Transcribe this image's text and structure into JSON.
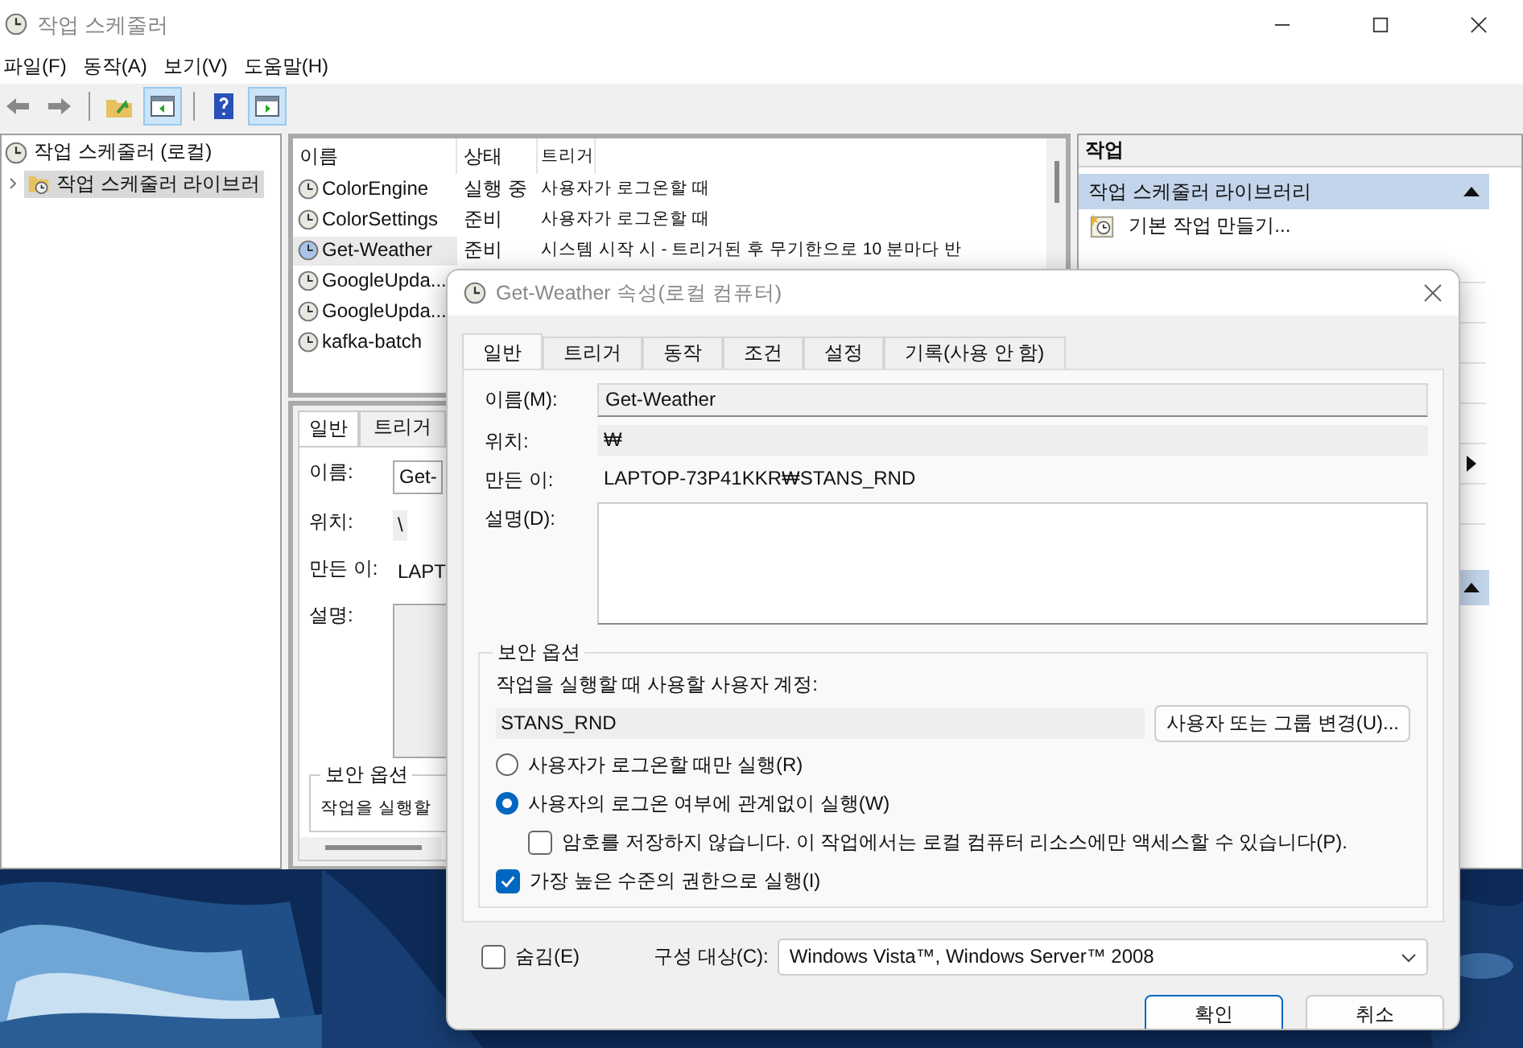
{
  "window": {
    "title": "작업 스케줄러"
  },
  "menu": [
    "파일(F)",
    "동작(A)",
    "보기(V)",
    "도움말(H)"
  ],
  "tree": [
    {
      "label": "작업 스케줄러 (로컬)",
      "selected": false,
      "children": [
        {
          "label": "작업 스케줄러 라이브러",
          "selected": true,
          "expanded": false
        }
      ]
    }
  ],
  "task_list": {
    "columns": [
      "이름",
      "상태",
      "트리거"
    ],
    "rows": [
      {
        "name": "ColorEngine",
        "status": "실행 중",
        "trigger": "사용자가 로그온할 때",
        "selected": false
      },
      {
        "name": "ColorSettings",
        "status": "준비",
        "trigger": "사용자가 로그온할 때",
        "selected": false
      },
      {
        "name": "Get-Weather",
        "status": "준비",
        "trigger": "시스템 시작 시 - 트리거된 후 무기한으로 10 분마다 반",
        "selected": true
      },
      {
        "name": "GoogleUpda...",
        "selected": false
      },
      {
        "name": "GoogleUpda...",
        "selected": false
      },
      {
        "name": "kafka-batch",
        "selected": false
      }
    ]
  },
  "details": {
    "tabs": [
      {
        "label": "일반",
        "selected": true
      },
      {
        "label": "트리거",
        "selected": false
      }
    ],
    "fields": [
      {
        "label": "이름:",
        "value": "Get-",
        "kind": "input"
      },
      {
        "label": "위치:",
        "value": "\\",
        "kind": "readonly"
      },
      {
        "label": "만든 이:",
        "value": "LAPT",
        "kind": "text"
      },
      {
        "label": "설명:",
        "kind": "textarea"
      }
    ],
    "security": {
      "title": "보안 옵션",
      "text": "작업을 실행할"
    }
  },
  "actions": {
    "title": "작업",
    "sections": [
      {
        "title": "작업 스케줄러 라이브러리",
        "expanded": true,
        "items": [
          {
            "label": "기본 작업 만들기..."
          }
        ]
      },
      {
        "expanded": true
      }
    ]
  },
  "dialog": {
    "title": "Get-Weather 속성(로컬 컴퓨터)",
    "tabs": [
      {
        "label": "일반",
        "selected": true
      },
      {
        "label": "트리거",
        "selected": false
      },
      {
        "label": "동작",
        "selected": false
      },
      {
        "label": "조건",
        "selected": false
      },
      {
        "label": "설정",
        "selected": false
      },
      {
        "label": "기록(사용 안 함)",
        "selected": false
      }
    ],
    "fields": [
      {
        "label": "이름(M):",
        "value": "Get-Weather",
        "kind": "input"
      },
      {
        "label": "위치:",
        "value": "₩",
        "kind": "readonly"
      },
      {
        "label": "만든 이:",
        "value": "LAPTOP-73P41KKR₩STANS_RND",
        "kind": "text"
      },
      {
        "label": "설명(D):",
        "kind": "textarea"
      }
    ],
    "security": {
      "title": "보안 옵션",
      "account_label": "작업을 실행할 때 사용할 사용자 계정:",
      "account": "STANS_RND",
      "change_button": "사용자 또는 그룹 변경(U)...",
      "options": [
        {
          "kind": "radio",
          "label": "사용자가 로그온할 때만 실행(R)",
          "selected": false
        },
        {
          "kind": "radio",
          "label": "사용자의 로그온 여부에 관계없이 실행(W)",
          "selected": true,
          "children": [
            {
              "kind": "checkbox",
              "label": "암호를 저장하지 않습니다. 이 작업에서는 로컬 컴퓨터 리소스에만 액세스할 수 있습니다(P).",
              "checked": false
            }
          ]
        },
        {
          "kind": "checkbox",
          "label": "가장 높은 수준의 권한으로 실행(I)",
          "checked": true
        }
      ]
    },
    "hidden": {
      "label": "숨김(E)",
      "checked": false
    },
    "configure": {
      "label": "구성 대상(C):",
      "value": "Windows Vista™, Windows Server™ 2008"
    },
    "buttons": [
      {
        "label": "확인",
        "default": true
      },
      {
        "label": "취소",
        "default": false
      }
    ]
  }
}
